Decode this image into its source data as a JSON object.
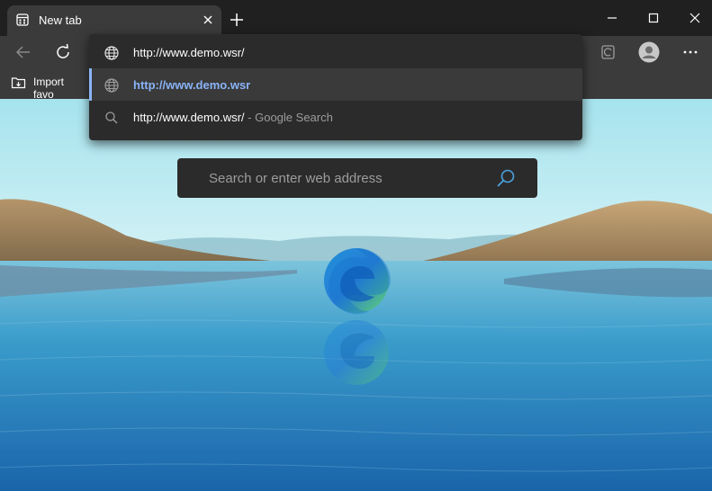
{
  "browser": {
    "tab": {
      "title": "New tab"
    },
    "favorites_bar": {
      "import_label": "Import favo"
    }
  },
  "omnibox_dropdown": {
    "typed_text": "http://www.demo.wsr/",
    "suggestions": [
      {
        "text": "http://www.demo.wsr",
        "icon": "globe-icon",
        "selected": true
      },
      {
        "text": "http://www.demo.wsr/",
        "suffix": "- Google Search",
        "icon": "search-icon"
      }
    ]
  },
  "page": {
    "search_placeholder": "Search or enter web address"
  },
  "colors": {
    "chrome_bg": "#202020",
    "toolbar_bg": "#3b3b3b",
    "dropdown_bg": "#2b2b2b",
    "accent": "#8ab4f8"
  }
}
